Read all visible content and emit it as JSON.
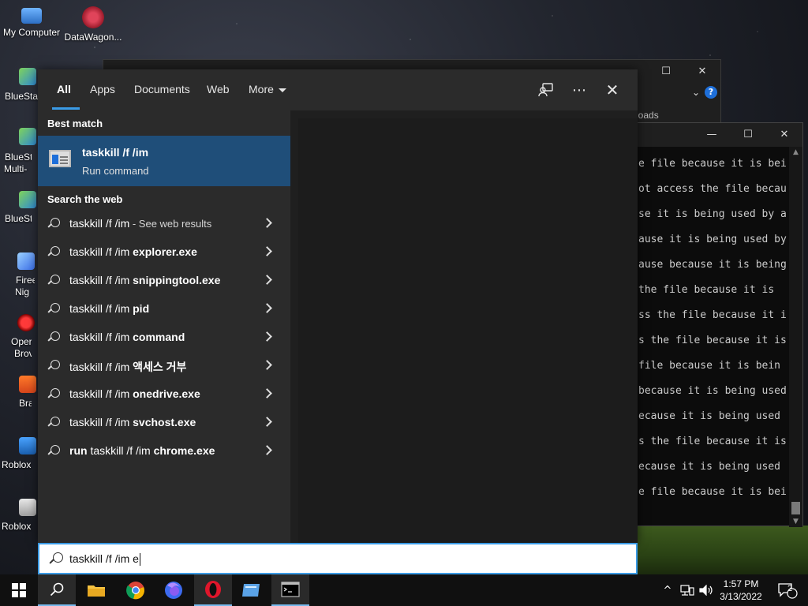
{
  "desktop": {
    "icons": [
      {
        "label": "My Computer"
      },
      {
        "label": "DataWagon..."
      }
    ],
    "side_labels": [
      "BlueStac",
      "BlueSt",
      "Multi-",
      "BlueSt",
      "Firee",
      "Nig",
      "Oper",
      "Brov",
      "Bra",
      "Roblox",
      "Roblox"
    ]
  },
  "explorer_window": {
    "partial_text": "loads",
    "help_label": "?"
  },
  "cmd_window": {
    "lines": [
      "e file because it is bei",
      "ot access the file becau",
      "se it is being used by a",
      "ause it is being used by",
      "ause because it is being us",
      " the file because it is",
      "ss the file because it i",
      "s the file because it is",
      " file because it is bein",
      "because it is being used",
      "ecause it is being used",
      "s the file because it is",
      "ecause it is being used",
      "e file because it is bei"
    ]
  },
  "search": {
    "tabs": [
      {
        "label": "All"
      },
      {
        "label": "Apps"
      },
      {
        "label": "Documents"
      },
      {
        "label": "Web"
      },
      {
        "label": "More"
      }
    ],
    "best_match_heading": "Best match",
    "best_match": {
      "title": "taskkill /f /im",
      "subtitle": "Run command"
    },
    "web_heading": "Search the web",
    "results": [
      {
        "prefix": "",
        "query": "taskkill /f /im",
        "bold": "",
        "suffix": " - See web results"
      },
      {
        "prefix": "",
        "query": "taskkill /f /im ",
        "bold": "explorer.exe",
        "suffix": ""
      },
      {
        "prefix": "",
        "query": "taskkill /f /im ",
        "bold": "snippingtool.exe",
        "suffix": ""
      },
      {
        "prefix": "",
        "query": "taskkill /f /im ",
        "bold": "pid",
        "suffix": ""
      },
      {
        "prefix": "",
        "query": "taskkill /f /im ",
        "bold": "command",
        "suffix": ""
      },
      {
        "prefix": "",
        "query": "taskkill /f /im ",
        "bold": "액세스 거부",
        "suffix": ""
      },
      {
        "prefix": "",
        "query": "taskkill /f /im ",
        "bold": "onedrive.exe",
        "suffix": ""
      },
      {
        "prefix": "",
        "query": "taskkill /f /im ",
        "bold": "svchost.exe",
        "suffix": ""
      },
      {
        "prefix": "run ",
        "query": "taskkill /f /im ",
        "bold": "chrome.exe",
        "suffix": ""
      }
    ],
    "query": "taskkill /f /im e"
  },
  "taskbar": {
    "time": "1:57 PM",
    "date": "3/13/2022",
    "notification_count": "2"
  },
  "colors": {
    "accent": "#3a9be6",
    "selected_bg": "#1f4e79",
    "panel_bg": "#2b2b2b"
  }
}
